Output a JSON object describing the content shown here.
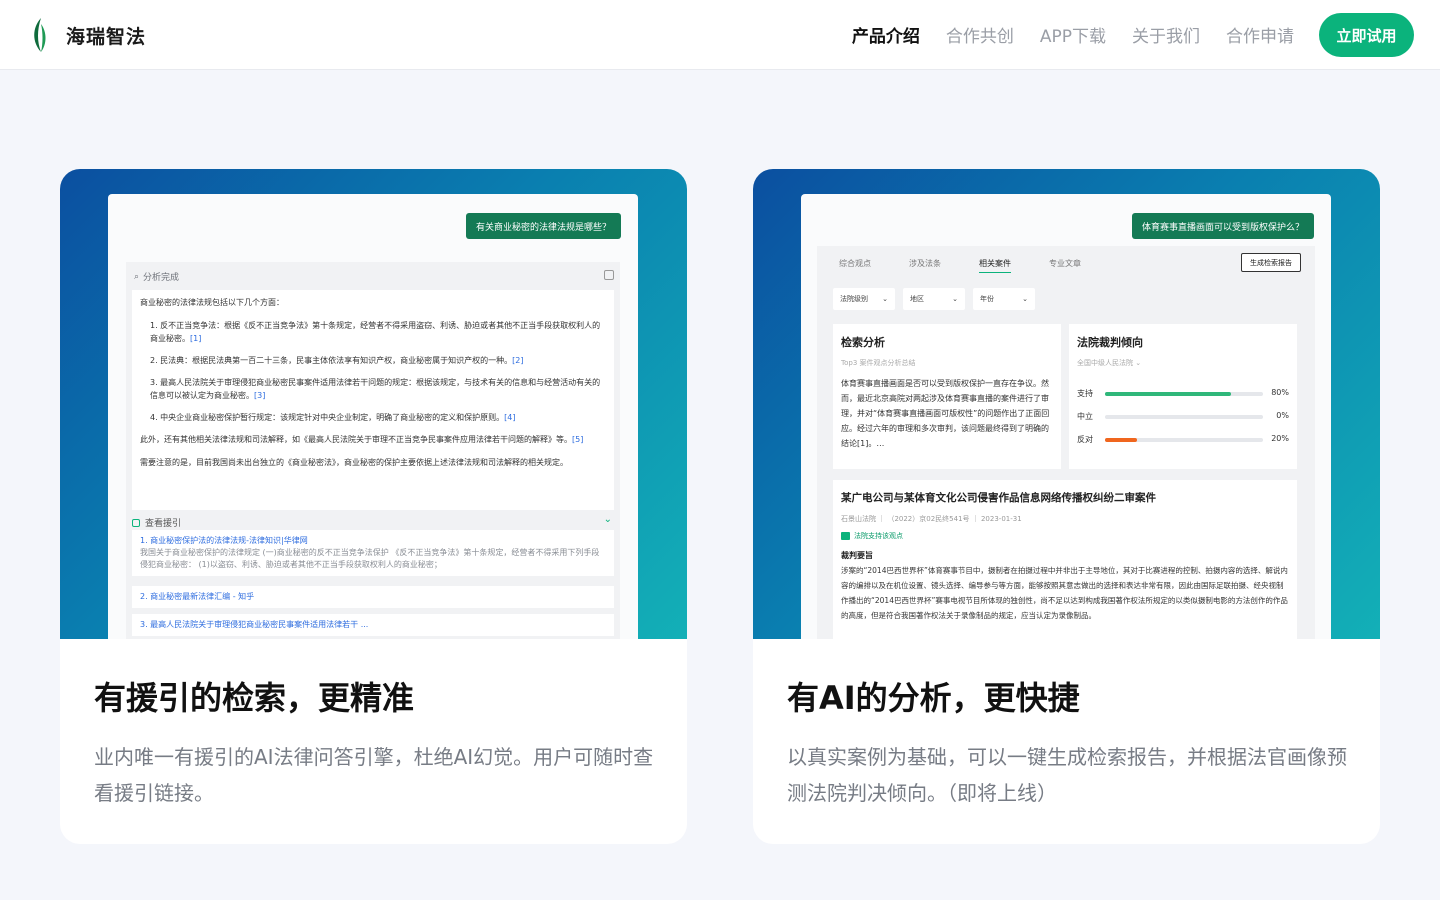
{
  "brand": {
    "name": "海瑞智法",
    "accent": "#0bb37c"
  },
  "nav": {
    "items": [
      {
        "label": "产品介绍",
        "active": true
      },
      {
        "label": "合作共创",
        "active": false
      },
      {
        "label": "APP下载",
        "active": false
      },
      {
        "label": "关于我们",
        "active": false
      },
      {
        "label": "合作申请",
        "active": false
      }
    ],
    "cta_label": "立即试用"
  },
  "cards": [
    {
      "title": "有援引的检索，更精准",
      "description": "业内唯一有援引的AI法律问答引擎，杜绝AI幻觉。用户可随时查看援引链接。",
      "mock": {
        "question": "有关商业秘密的法律法规是哪些？",
        "status": "分析完成",
        "intro": "商业秘密的法律法规包括以下几个方面：",
        "points": [
          {
            "text": "1. 反不正当竞争法：根据《反不正当竞争法》第十条规定，经营者不得采用盗窃、利诱、胁迫或者其他不正当手段获取权利人的商业秘密。",
            "ref": "[1]"
          },
          {
            "text": "2. 民法典：根据民法典第一百二十三条，民事主体依法享有知识产权，商业秘密属于知识产权的一种。",
            "ref": "[2]"
          },
          {
            "text": "3. 最高人民法院关于审理侵犯商业秘密民事案件适用法律若干问题的规定：根据该规定，与技术有关的信息和与经营活动有关的信息可以被认定为商业秘密。",
            "ref": "[3]"
          },
          {
            "text": "4. 中央企业商业秘密保护暂行规定：该规定针对中央企业制定，明确了商业秘密的定义和保护原则。",
            "ref": "[4]"
          }
        ],
        "extra": "此外，还有其他相关法律法规和司法解释，如《最高人民法院关于审理不正当竞争民事案件应用法律若干问题的解释》等。",
        "extra_ref": "[5]",
        "note": "需要注意的是，目前我国尚未出台独立的《商业秘密法》，商业秘密的保护主要依据上述法律法规和司法解释的相关规定。",
        "citations_label": "查看援引",
        "citations": [
          {
            "title": "1. 商业秘密保护法的法律法规-法律知识|华律网",
            "snippet": "我国关于商业秘密保护的法律规定 (一)商业秘密的反不正当竞争法保护 《反不正当竞争法》第十条规定，经营者不得采用下列手段侵犯商业秘密： (1)以盗窃、利诱、胁迫或者其他不正当手段获取权利人的商业秘密；"
          },
          {
            "title": "2. 商业秘密最新法律汇编 - 知乎",
            "snippet": ""
          },
          {
            "title": "3. 最高人民法院关于审理侵犯商业秘密民事案件适用法律若干 ...",
            "snippet": ""
          }
        ]
      }
    },
    {
      "title": "有AI的分析，更快捷",
      "description": "以真实案例为基础，可以一键生成检索报告，并根据法官画像预测法院判决倾向。（即将上线）",
      "mock": {
        "question": "体育赛事直播画面可以受到版权保护么？",
        "tabs": [
          {
            "label": "综合观点",
            "active": false
          },
          {
            "label": "涉及法条",
            "active": false
          },
          {
            "label": "相关案件",
            "active": true
          },
          {
            "label": "专业文章",
            "active": false
          }
        ],
        "report_button": "生成检索报告",
        "filters": [
          "法院级别",
          "地区",
          "年份"
        ],
        "analysis": {
          "title": "检索分析",
          "subtitle": "Top3 案件观点分析总结",
          "text": "体育赛事直播画面是否可以受到版权保护一直存在争议。然而，最近北京高院对两起涉及体育赛事直播的案件进行了审理，并对“体育赛事直播画面可版权性”的问题作出了正面回应。经过六年的审理和多次审判，该问题最终得到了明确的结论[1]。…"
        },
        "tendency": {
          "title": "法院裁判倾向",
          "subtitle": "全国中级人民法院",
          "bars": [
            {
              "label": "支持",
              "value": 80,
              "display": "80%",
              "color": "#2fb77a"
            },
            {
              "label": "中立",
              "value": 0,
              "display": "0%",
              "color": "#2fb77a"
            },
            {
              "label": "反对",
              "value": 20,
              "display": "20%",
              "color": "#f0661e"
            }
          ]
        },
        "case": {
          "title": "某广电公司与某体育文化公司侵害作品信息网络传播权纠纷二审案件",
          "meta": "石景山法院 ｜ （2022）京02民终541号 ｜ 2023-01-31",
          "badge": "法院支持该观点",
          "section": "裁判要旨",
          "text": "涉案的“2014巴西世界杯”体育赛事节目中，摄制者在拍摄过程中并非出于主导地位，其对于比赛进程的控制、拍摄内容的选择、解说内容的编排以及在机位设置、镜头选择、编导参与等方面，能够按照其意志做出的选择和表达非常有限，因此由国际足联拍摄、经央视制作播出的“2014巴西世界杯”赛事电视节目所体现的独创性，尚不足以达到构成我国著作权法所规定的以类似摄制电影的方法创作的作品的高度，但是符合我国著作权法关于录像制品的规定，应当认定为录像制品。"
        }
      }
    }
  ]
}
